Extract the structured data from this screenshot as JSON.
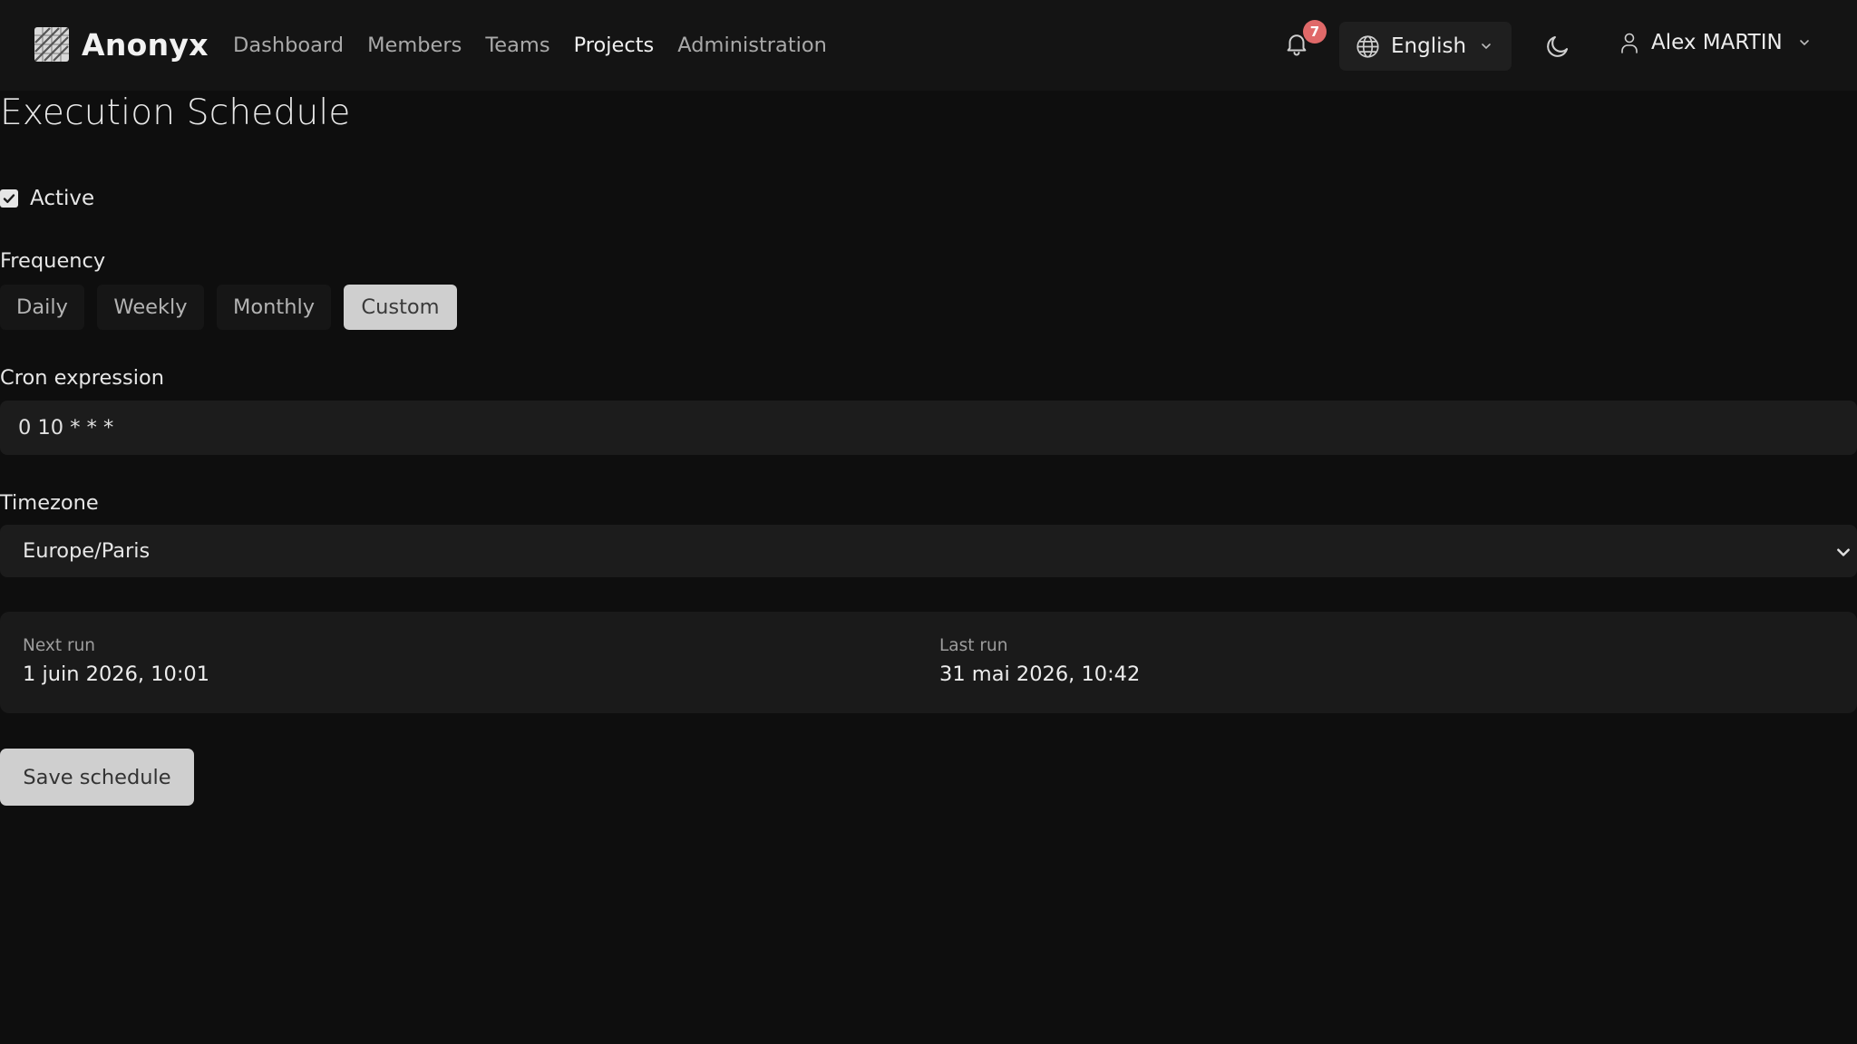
{
  "header": {
    "brand_name": "Anonyx",
    "logo_icon": "brand-logo-icon",
    "nav": [
      "Dashboard",
      "Members",
      "Teams",
      "Projects",
      "Administration"
    ],
    "active_nav": "Projects",
    "notifications_count": "7",
    "language": "English",
    "user_name": "Alex MARTIN"
  },
  "page": {
    "title": "Execution Schedule"
  },
  "form": {
    "active_label": "Active",
    "active_checked": true,
    "frequency_label": "Frequency",
    "frequency_options": [
      "Daily",
      "Weekly",
      "Monthly",
      "Custom"
    ],
    "frequency_selected": "Custom",
    "cron_label": "Cron expression",
    "cron_value": "0 10 * * *",
    "timezone_label": "Timezone",
    "timezone_value": "Europe/Paris"
  },
  "runs": {
    "next_label": "Next run",
    "next_value": "1 juin 2026, 10:01",
    "last_label": "Last run",
    "last_value": "31 mai 2026, 10:42"
  },
  "actions": {
    "save_label": "Save schedule"
  },
  "colors": {
    "background": "#0e0e0e",
    "navbar": "#141414",
    "badge": "#e06969",
    "selected_button": "#cfcfcf",
    "input_bg": "#1c1c1c"
  }
}
